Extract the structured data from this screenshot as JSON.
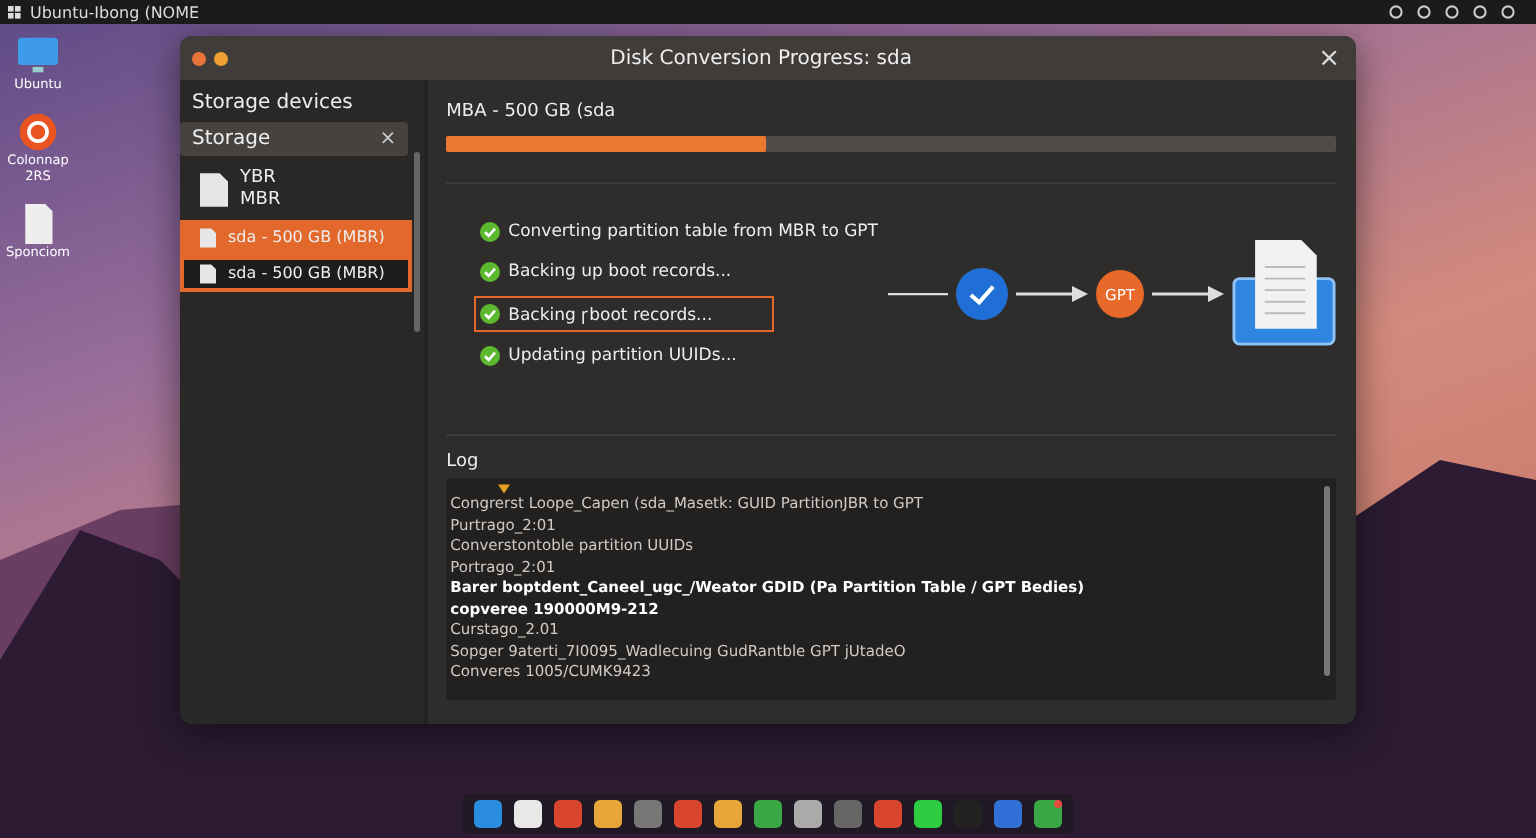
{
  "top_bar": {
    "title": "Ubuntu-Ibong (NOME"
  },
  "desktop_icons": [
    {
      "label": "Ubuntu",
      "kind": "monitor"
    },
    {
      "label": "Colonnap\n2RS",
      "kind": "ubuntu"
    },
    {
      "label": "Sponciom",
      "kind": "document"
    }
  ],
  "window": {
    "title": "Disk Conversion Progress: sda",
    "close": "×"
  },
  "sidebar": {
    "heading": "Storage devices",
    "section": "Storage",
    "section_close": "×",
    "items": [
      {
        "label": "YBR\nMBR",
        "selected": false,
        "outlined": false,
        "kind": "large"
      },
      {
        "label": "sda - 500 GB (MBR)",
        "selected": true,
        "outlined": false,
        "kind": "small"
      },
      {
        "label": "sda - 500 GB (MBR)",
        "selected": false,
        "outlined": true,
        "kind": "small"
      }
    ]
  },
  "progress": {
    "label": "MBA - 500 GB (sda",
    "level": 0.36
  },
  "steps": [
    {
      "label": "Converting partition table from MBR to GPT",
      "done": true,
      "highlighted": false
    },
    {
      "label": "Backing up boot records...",
      "done": true,
      "highlighted": false
    },
    {
      "label": "Backing ꞅboot records...",
      "done": true,
      "highlighted": true
    },
    {
      "label": "Updating partition UUIDs...",
      "done": true,
      "highlighted": false
    }
  ],
  "diagram": {
    "badge": "GPT"
  },
  "log": {
    "label": "Log",
    "lines": [
      {
        "text": "Congrerst Loope_Capen (sda_Masetk: GUID PartitionJBR to GPT",
        "kind": "plain"
      },
      {
        "text": "Purtrago_2:01",
        "kind": "plain"
      },
      {
        "text": "Converstontoble partition UUIDs",
        "kind": "plain"
      },
      {
        "text": "Portrago_2:01",
        "kind": "plain"
      },
      {
        "text": "Barer boptdent_Caneel_ugc_/Weator GDID (Pa Partition Table / GPT Bedies)",
        "kind": "bold"
      },
      {
        "text": "copveree 190000M9-212",
        "kind": "bold"
      },
      {
        "text": "Curstago_2.01",
        "kind": "plain"
      },
      {
        "text": "Sopger 9aterti_7I0095_Wadlecuing GudRantble GPT jUtadeO",
        "kind": "plain"
      },
      {
        "text": "Converes 1005/CUMK9423",
        "kind": "plain"
      }
    ]
  }
}
